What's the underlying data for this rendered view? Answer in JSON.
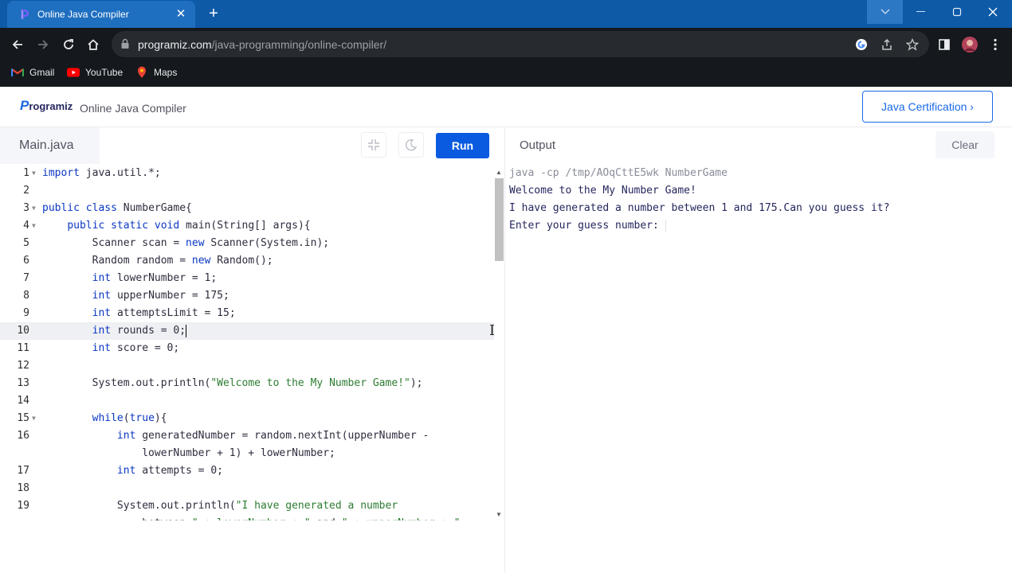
{
  "browser": {
    "tab_title": "Online Java Compiler",
    "url_host": "programiz.com",
    "url_path": "/java-programming/online-compiler/",
    "bookmarks": [
      {
        "label": "Gmail",
        "icon": "gmail-icon"
      },
      {
        "label": "YouTube",
        "icon": "youtube-icon"
      },
      {
        "label": "Maps",
        "icon": "maps-icon"
      }
    ]
  },
  "site": {
    "logo_p": "P",
    "logo_text": "rogramiz",
    "title": "Online Java Compiler",
    "cert_button": "Java Certification ›"
  },
  "editor": {
    "file_name": "Main.java",
    "run_label": "Run",
    "lines": [
      {
        "n": "1",
        "fold": true,
        "code": "import java.util.*;"
      },
      {
        "n": "2",
        "fold": false,
        "code": ""
      },
      {
        "n": "3",
        "fold": true,
        "code": "public class NumberGame{"
      },
      {
        "n": "4",
        "fold": true,
        "code": "    public static void main(String[] args){"
      },
      {
        "n": "5",
        "fold": false,
        "code": "        Scanner scan = new Scanner(System.in);"
      },
      {
        "n": "6",
        "fold": false,
        "code": "        Random random = new Random();"
      },
      {
        "n": "7",
        "fold": false,
        "code": "        int lowerNumber = 1;"
      },
      {
        "n": "8",
        "fold": false,
        "code": "        int upperNumber = 175;"
      },
      {
        "n": "9",
        "fold": false,
        "code": "        int attemptsLimit = 15;"
      },
      {
        "n": "10",
        "fold": false,
        "code": "        int rounds = 0;",
        "active": true
      },
      {
        "n": "11",
        "fold": false,
        "code": "        int score = 0;"
      },
      {
        "n": "12",
        "fold": false,
        "code": ""
      },
      {
        "n": "13",
        "fold": false,
        "code": "        System.out.println(\"Welcome to the My Number Game!\");"
      },
      {
        "n": "14",
        "fold": false,
        "code": ""
      },
      {
        "n": "15",
        "fold": true,
        "code": "        while(true){"
      },
      {
        "n": "16",
        "fold": false,
        "code": "            int generatedNumber = random.nextInt(upperNumber -"
      },
      {
        "n": "",
        "fold": false,
        "code": "                lowerNumber + 1) + lowerNumber;"
      },
      {
        "n": "17",
        "fold": false,
        "code": "            int attempts = 0;"
      },
      {
        "n": "18",
        "fold": false,
        "code": ""
      },
      {
        "n": "19",
        "fold": false,
        "code": "            System.out.println(\"I have generated a number"
      },
      {
        "n": "",
        "fold": false,
        "code": "                between \" + lowerNumber + \" and \" + upperNumber + \""
      }
    ]
  },
  "output": {
    "title": "Output",
    "clear_label": "Clear",
    "lines": [
      {
        "text": "java -cp /tmp/AOqCttE5wk NumberGame",
        "cmd": true
      },
      {
        "text": "Welcome to the My Number Game!",
        "cmd": false
      },
      {
        "text": "I have generated a number between 1 and 175.Can you guess it?",
        "cmd": false
      },
      {
        "text": "Enter your guess number: ",
        "cmd": false,
        "prompt": true
      }
    ]
  }
}
